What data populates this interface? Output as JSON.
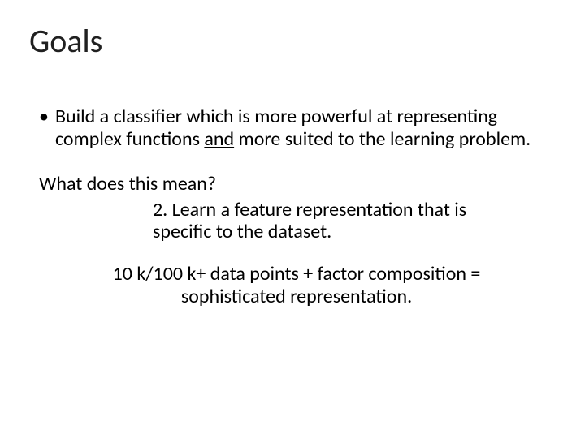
{
  "slide": {
    "title": "Goals",
    "bullet_marker": "•",
    "bullet1_a": "Build a classifier which is more powerful at representing complex functions ",
    "bullet1_u": "and",
    "bullet1_b": " more suited to the learning problem.",
    "question": "What does this mean?",
    "num2": "2. Learn a feature representation that is specific to the dataset.",
    "equation": "10 k/100 k+ data points + factor composition = sophisticated representation."
  }
}
